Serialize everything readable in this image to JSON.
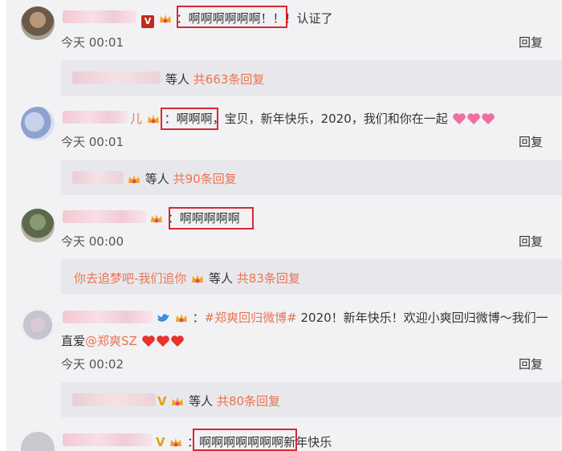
{
  "c1": {
    "content": "：啊啊啊啊啊啊！！！认证了",
    "time": "今天 00:01",
    "reply": "回复",
    "sub": {
      "suffix": "等人",
      "count": "共663条回复"
    }
  },
  "c2": {
    "name_tail": "儿",
    "content_hl": "：啊啊啊，",
    "content_rest": "宝贝，新年快乐，2020，我们和你在一起",
    "time": "今天 00:01",
    "reply": "回复",
    "sub": {
      "suffix": "等人",
      "count": "共90条回复"
    }
  },
  "c3": {
    "content": "：啊啊啊啊啊",
    "time": "今天 00:00",
    "reply": "回复",
    "sub": {
      "name": "你去追梦吧-我们追你",
      "suffix": "等人",
      "count": "共83条回复"
    }
  },
  "c4": {
    "colon": "：",
    "hashtag": "#郑爽回归微博#",
    "content": "2020！新年快乐！欢迎小爽回归微博～我们一",
    "line2_prefix": "直爱",
    "mention": "@郑爽SZ",
    "time": "今天 00:02",
    "reply": "回复",
    "sub": {
      "suffix": "等人",
      "count": "共80条回复"
    }
  },
  "c5": {
    "content_hl": "：啊啊啊啊啊啊啊",
    "content_rest": "新年快乐"
  },
  "icons": {
    "crown": "crown-badge-icon",
    "verified": "v-verified-icon",
    "heart_pink": "pink-heart-icon",
    "heart_red": "red-heart-icon",
    "bird": "blue-bird-icon"
  },
  "colors": {
    "link_orange": "#eb7350",
    "highlight_red": "#d9282f",
    "background": "#f2f2f5",
    "subbox": "#e8e8ec"
  }
}
